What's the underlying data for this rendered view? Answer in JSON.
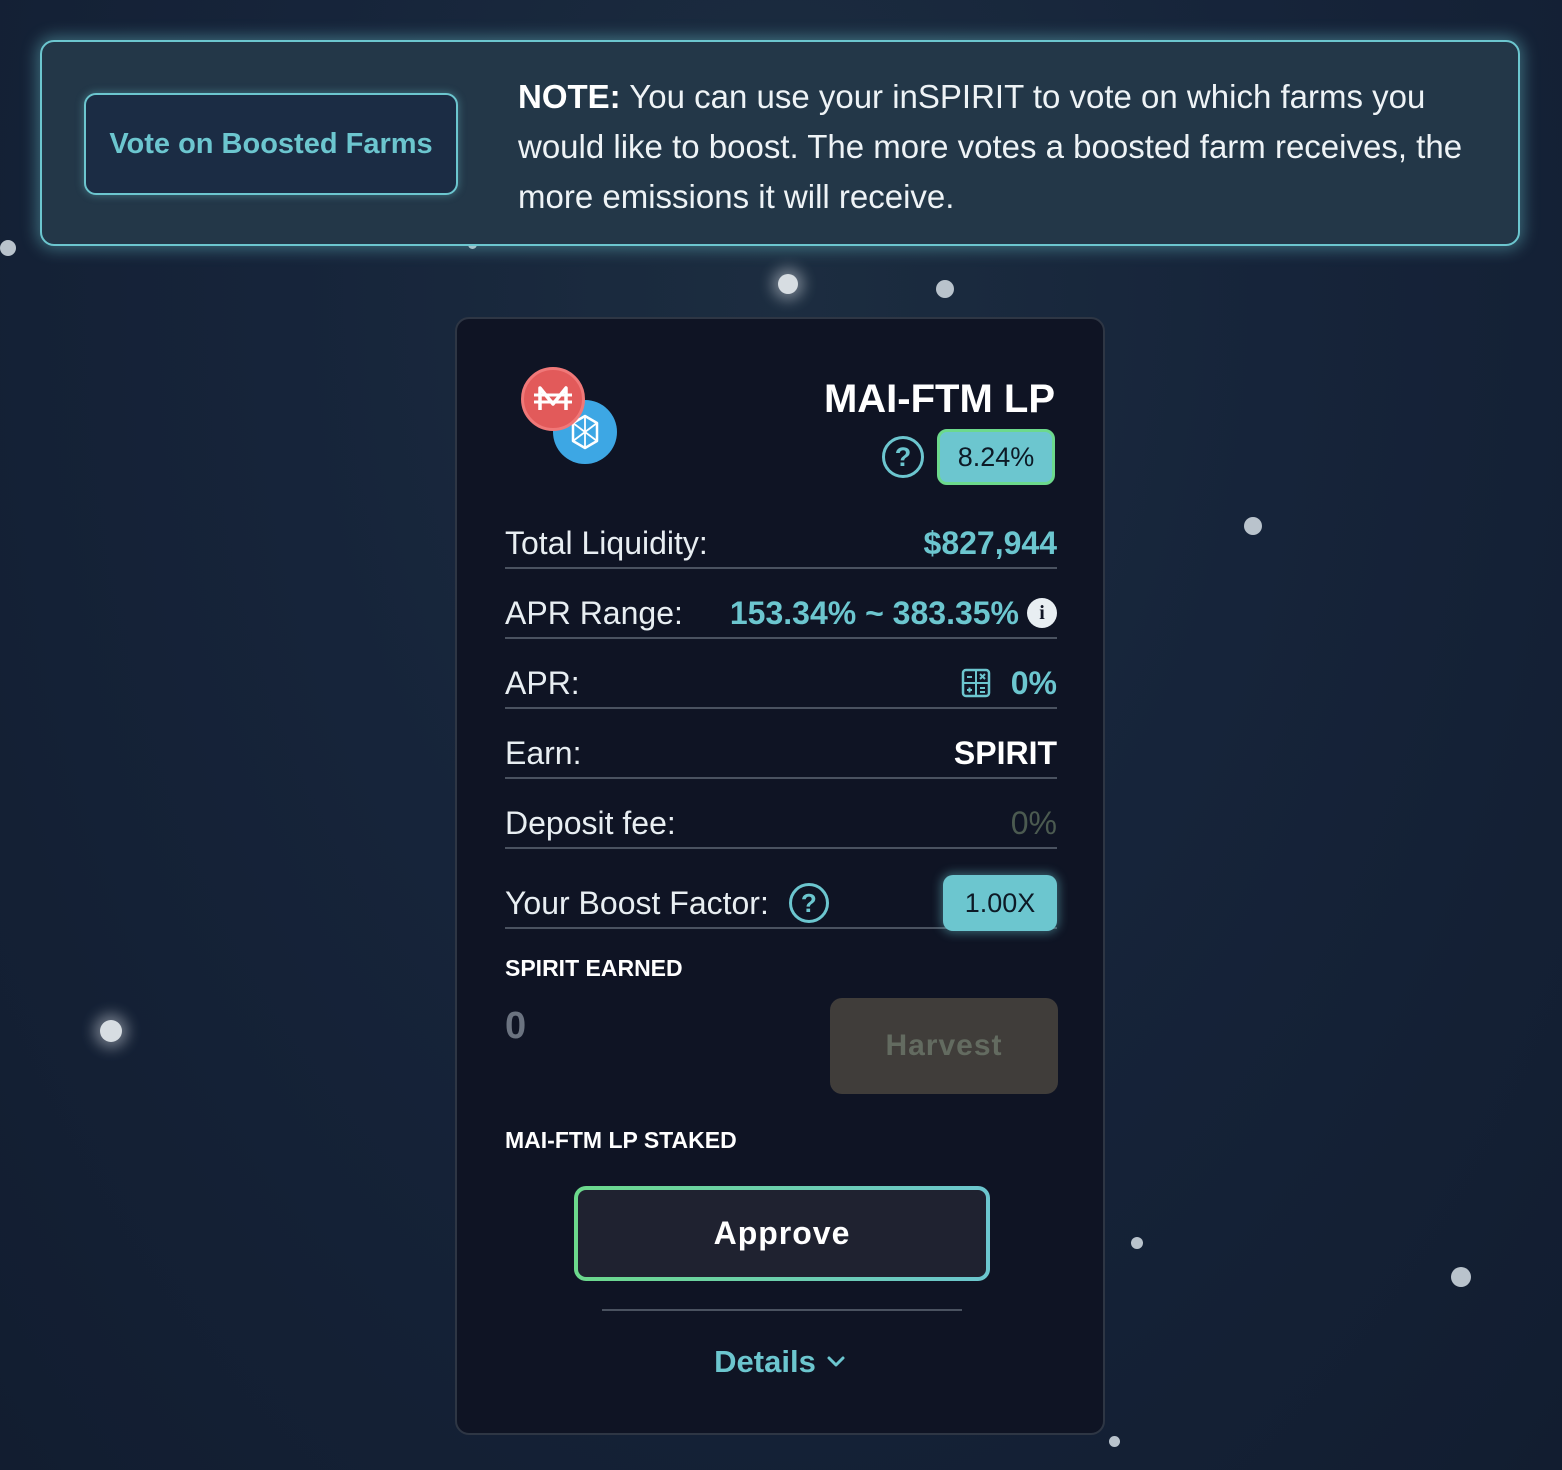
{
  "banner": {
    "vote_button": "Vote on Boosted Farms",
    "note_prefix": "NOTE:",
    "note_body": " You can use your inSPIRIT to vote on which farms you would like to boost. The more votes a boosted farm receives, the more emissions it will receive."
  },
  "farm": {
    "title": "MAI-FTM LP",
    "multiplier": "8.24%",
    "help_glyph": "?",
    "token_a_icon": "mai-token-icon",
    "token_b_icon": "ftm-token-icon",
    "rows": {
      "total_liquidity": {
        "label": "Total Liquidity:",
        "value": "$827,944"
      },
      "apr_range": {
        "label": "APR Range:",
        "value": "153.34% ~ 383.35%"
      },
      "apr": {
        "label": "APR:",
        "value": "0%"
      },
      "earn": {
        "label": "Earn:",
        "value": "SPIRIT"
      },
      "deposit_fee": {
        "label": "Deposit fee:",
        "value": "0%"
      },
      "boost": {
        "label": "Your Boost Factor:",
        "value": "1.00X"
      }
    },
    "earned_label": "SPIRIT EARNED",
    "earned_amount": "0",
    "harvest_label": "Harvest",
    "staked_label": "MAI-FTM LP STAKED",
    "approve_label": "Approve",
    "details_label": "Details"
  },
  "colors": {
    "accent": "#6cc6cf",
    "accent_green": "#6cd98c",
    "background": "#16243a",
    "card": "#0f1424"
  }
}
